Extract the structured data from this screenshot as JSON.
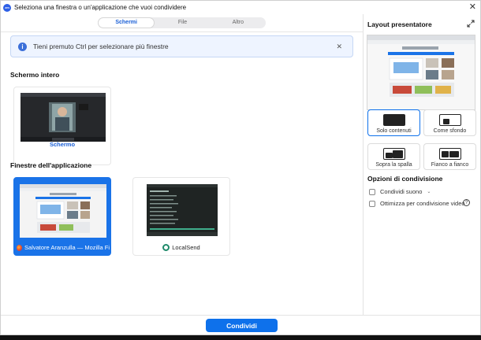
{
  "window": {
    "title": "Seleziona una finestra o un'applicazione che vuoi condividere"
  },
  "tabs": [
    {
      "label": "Schermi",
      "active": true
    },
    {
      "label": "File",
      "active": false
    },
    {
      "label": "Altro",
      "active": false
    }
  ],
  "info": {
    "text": "Tieni premuto Ctrl per selezionare più finestre"
  },
  "sections": {
    "screen_title": "Schermo intero",
    "apps_title": "Finestre dell'applicazione"
  },
  "screen_card": {
    "label": "Schermo"
  },
  "app_cards": [
    {
      "label": "Salvatore Aranzulla — Mozilla Firef...",
      "selected": true,
      "icon": "firefox-icon"
    },
    {
      "label": "LocalSend",
      "selected": false,
      "icon": "localsend-icon"
    }
  ],
  "presenter": {
    "title": "Layout presentatore",
    "options": [
      {
        "label": "Solo contenuti",
        "selected": true
      },
      {
        "label": "Come sfondo",
        "selected": false
      },
      {
        "label": "Sopra la spalla",
        "selected": false
      },
      {
        "label": "Fianco a fianco",
        "selected": false
      }
    ]
  },
  "sharing_options": {
    "title": "Opzioni di condivisione",
    "share_sound": "Condividi suono",
    "optimize_video": "Ottimizza per condivisione video"
  },
  "footer": {
    "share_button": "Condividi"
  },
  "colors": {
    "accent": "#0e71eb",
    "selected_card": "#1a73e8",
    "info_bg": "#eef4ff"
  }
}
